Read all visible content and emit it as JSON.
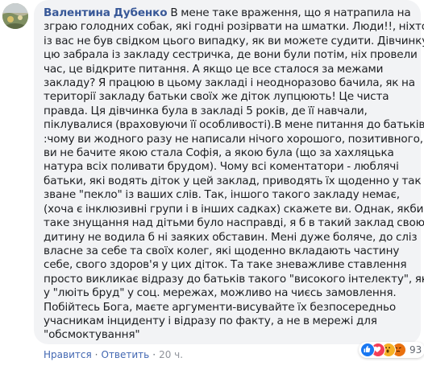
{
  "comment": {
    "author": "Валентина Дубенко",
    "lines": [
      "В мене таке враження, що я натрапила на",
      "зграю голодних собак, які годні розірвати на шматки. Люди!!, ніхто",
      "із вас не був свідком цього випадку, як ви можете судити. Дівчинку",
      "цю забрала із закладу сестричка, де вони були потім, ніх провели",
      "час, це відкрите питання. А якщо це все сталося за межами",
      "закладу? Я працюю в цьому закладі і неодноразово бачила, як на",
      "території закладу батьки своїх же діток лупцюють! Це чиста",
      "правда. Ця дівчинка була в закладі 5 років, де її навчали,",
      "піклувалися (враховуючи її особливості).В мене питання до батьків",
      ":чому ви жодного разу не написали нічого хорошого, позитивного,",
      "ви не бачите якою стала Софія, а якою була (що за хахляцька",
      "натура всіх поливати брудом). Чому всі коментатори - люблячі",
      "батьки, які водять діток у цей заклад, приводять їх щоденно у так",
      "зване \"пекло\" із ваших слів. Так, іншого такого закладу немає,",
      "(хоча є інклюзивні групи і в інших садках) скажете ви. Однак, якби",
      "таке знущання над дітьми було насправді, я б в такий заклад свою",
      "дитину не водила б ні заяких обставин. Мені дуже боляче, до сліз",
      "власне за себе та своїх колег, які щоденно вкладають частину",
      "себе, свого здоров'я у цих діток. Та таке зневажливе ставлення",
      "просто викликає відразу до батьків такого \"високого інтелекту\", які",
      "у \"люіть бруд\" у соц. мережах, можливо на чиєсь замовлення.",
      "Побійтесь Бога, маєте аргументи-висувайте їх безпосередньо",
      "учасникам інциденту і відразу по факту, а не в мережі для",
      "\"обсмоктування\""
    ]
  },
  "actions": {
    "like": "Нравится",
    "reply": "Ответить",
    "separator": "·",
    "time": "20 ч."
  },
  "reactions": {
    "count": "93",
    "icons": [
      "like-icon",
      "love-icon",
      "wow-icon",
      "angry-icon"
    ]
  },
  "colors": {
    "author": "#385898",
    "action_link": "#4267b2",
    "bubble": "#f2f3f5",
    "like": "#1877f2",
    "love": "#f33e58",
    "wow": "#f7b125",
    "angry": "#e9710f"
  }
}
